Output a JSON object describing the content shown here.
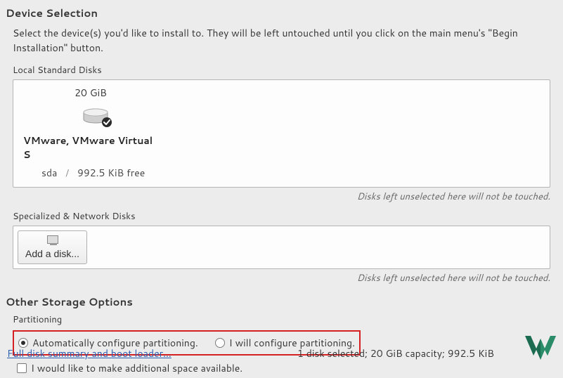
{
  "device_selection": {
    "title": "Device Selection",
    "description": "Select the device(s) you'd like to install to.  They will be left untouched until you click on the main menu's \"Begin Installation\" button.",
    "local_disks_label": "Local Standard Disks",
    "disk": {
      "size": "20 GiB",
      "name": "VMware, VMware Virtual S",
      "dev": "sda",
      "free": "992.5 KiB free"
    },
    "unselected_hint": "Disks left unselected here will not be touched.",
    "network_disks_label": "Specialized & Network Disks",
    "add_disk_label": "Add a disk..."
  },
  "other_storage": {
    "title": "Other Storage Options",
    "partitioning_label": "Partitioning",
    "radio_auto": "Automatically configure partitioning.",
    "radio_manual": "I will configure partitioning.",
    "checkbox_additional": "I would like to make additional space available."
  },
  "footer": {
    "link": "Full disk summary and boot loader...",
    "status": "1 disk selected; 20 GiB capacity; 992.5 KiB"
  }
}
